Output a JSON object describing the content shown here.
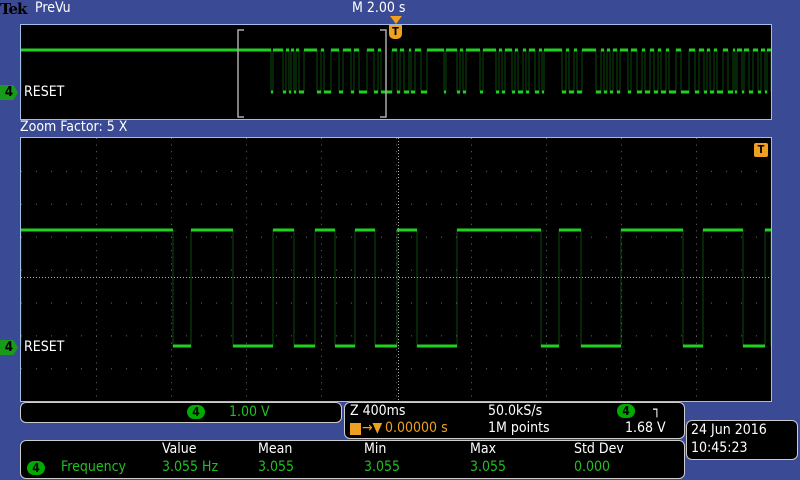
{
  "header": {
    "brand": "Tek",
    "mode": "PreVu",
    "timebase": "M 2.00 s"
  },
  "preview": {
    "channel": "4",
    "label": "RESET"
  },
  "zoom_factor": "Zoom Factor: 5 X",
  "main": {
    "channel": "4",
    "label": "RESET",
    "trigger_marker": "T"
  },
  "channel_box": {
    "channel": "4",
    "scale": "1.00 V"
  },
  "acq_box": {
    "zoom_time": "Z 400ms",
    "sample_rate": "50.0kS/s",
    "trigger_channel": "4",
    "slope_icon": "falling-edge",
    "trigger_pos": "0.00000 s",
    "record_length": "1M points",
    "trigger_level": "1.68 V"
  },
  "datetime": {
    "date": "24 Jun  2016",
    "time": "10:45:23"
  },
  "measurements": {
    "headers": [
      "Value",
      "Mean",
      "Min",
      "Max",
      "Std Dev"
    ],
    "channel": "4",
    "name": "Frequency",
    "values": [
      "3.055 Hz",
      "3.055",
      "3.055",
      "3.055",
      "0.000"
    ]
  },
  "colors": {
    "trace": "#20d020",
    "trigger": "#f0a020",
    "background": "#3a4a94"
  }
}
